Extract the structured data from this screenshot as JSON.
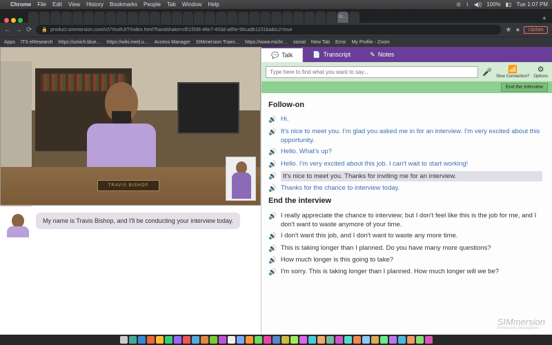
{
  "mac_menu": {
    "app": "Chrome",
    "items": [
      "File",
      "Edit",
      "View",
      "History",
      "Bookmarks",
      "People",
      "Tab",
      "Window",
      "Help"
    ],
    "battery": "100%",
    "time": "Tue 1:07 PM"
  },
  "browser": {
    "url": "product.simmersion.com/v2/YouthJIT/index.html?handshake=cf01f336-46e7-453d-a85e-96cadb1231ba&tc2=true",
    "update": "Update",
    "bookmarks": [
      "Apps",
      "ITS eResearch",
      "https://umich.blue…",
      "https://wiki.med.u…",
      "Access Manager",
      "SIMmersion Traini…",
      "https://www.michr…",
      "social",
      "New Tab",
      "Error",
      "My Profile - Zoom"
    ]
  },
  "video": {
    "nameplate": "TRAVIS BISHOP"
  },
  "caption": "My name is Travis Bishop, and I'll be conducting your interview today.",
  "tabs": {
    "talk": "Talk",
    "transcript": "Transcript",
    "notes": "Notes"
  },
  "search_placeholder": "Type here to find what you want to say...",
  "options": {
    "slow": "Slow Connection?",
    "opts": "Options"
  },
  "end_interview_btn": "End the Interview",
  "sections": [
    {
      "title": "Follow-on",
      "lines": [
        {
          "style": "blue",
          "text": "Hi."
        },
        {
          "style": "blue",
          "text": "It's nice to meet you. I'm glad you asked me in for an interview. I'm very excited about this opportunity."
        },
        {
          "style": "blue",
          "text": "Hello. What's up?"
        },
        {
          "style": "blue",
          "text": "Hello. I'm very excited about this job. I can't wait to start working!"
        },
        {
          "style": "sel",
          "text": "It's nice to meet you. Thanks for inviting me for an interview."
        },
        {
          "style": "blue",
          "text": "Thanks for the chance to interview today."
        }
      ]
    },
    {
      "title": "End the interview",
      "lines": [
        {
          "style": "",
          "text": "I really appreciate the chance to interview; but I don't feel like this is the job for me, and I don't want to waste anymore of your time."
        },
        {
          "style": "",
          "text": "I don't want this job, and I don't want to waste any more time."
        },
        {
          "style": "",
          "text": "This is taking longer than I planned. Do you have many more questions?"
        },
        {
          "style": "",
          "text": "How much longer is this going to take?"
        },
        {
          "style": "",
          "text": "I'm sorry. This is taking longer than I planned. How much longer will we be?"
        }
      ]
    }
  ],
  "watermark": {
    "main": "SIMmersion",
    "sub": "Immersive Simulations"
  },
  "dock_colors": [
    "#ccc",
    "#4a9",
    "#38d",
    "#e63",
    "#fb3",
    "#3c7",
    "#96f",
    "#e55",
    "#5ad",
    "#d84",
    "#7c3",
    "#b5d",
    "#eee",
    "#7af",
    "#f93",
    "#6d6",
    "#e4a",
    "#58c",
    "#cb4",
    "#9e5",
    "#d6e",
    "#4cd",
    "#ea6",
    "#7b9",
    "#c5c",
    "#5dc",
    "#e85",
    "#8cf",
    "#da5",
    "#6e8",
    "#b7e",
    "#4bd",
    "#e96",
    "#8d7",
    "#d5b"
  ]
}
